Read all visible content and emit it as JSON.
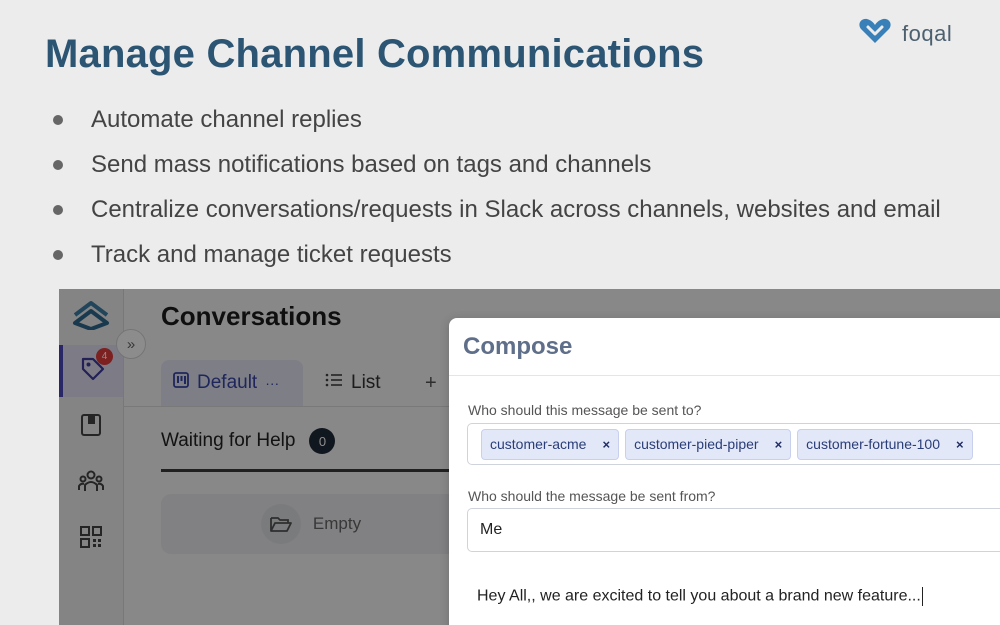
{
  "slide": {
    "title": "Manage Channel Communications",
    "brand": {
      "name": "foqal",
      "logo_icon": "foqal-heart-logo-icon",
      "color": "#3a80b8"
    },
    "bullets": [
      "Automate channel replies",
      "Send mass notifications based on tags and channels",
      "Centralize conversations/requests in Slack across channels, websites and email",
      "Track and manage ticket requests"
    ]
  },
  "app": {
    "title": "Conversations",
    "sidebar": {
      "items": [
        {
          "icon": "foqal-logo-icon"
        },
        {
          "icon": "tag-icon",
          "badge": "4",
          "active": true
        },
        {
          "icon": "book-icon"
        },
        {
          "icon": "users-icon"
        },
        {
          "icon": "dashboard-icon"
        }
      ],
      "collapse_icon": "double-chevron-right-icon"
    },
    "tabs": [
      {
        "label": "Default",
        "icon": "kanban-icon",
        "more": "···",
        "active": true
      },
      {
        "label": "List",
        "icon": "list-icon"
      },
      {
        "label": "+"
      }
    ],
    "column": {
      "title": "Waiting for Help",
      "count": "0",
      "empty_text": "Empty",
      "empty_icon": "folder-open-icon"
    }
  },
  "compose": {
    "title": "Compose",
    "to_label": "Who should this message be sent to?",
    "recipients": [
      "customer-acme",
      "customer-pied-piper",
      "customer-fortune-100"
    ],
    "remove_glyph": "×",
    "from_label": "Who should the message be sent from?",
    "from_value": "Me",
    "message": "Hey All,, we are excited to tell you about a brand new feature..."
  },
  "colors": {
    "title": "#2b5573",
    "accent": "#4b47b8",
    "badge": "#e33b3b",
    "chip": "#e3e8f8"
  }
}
